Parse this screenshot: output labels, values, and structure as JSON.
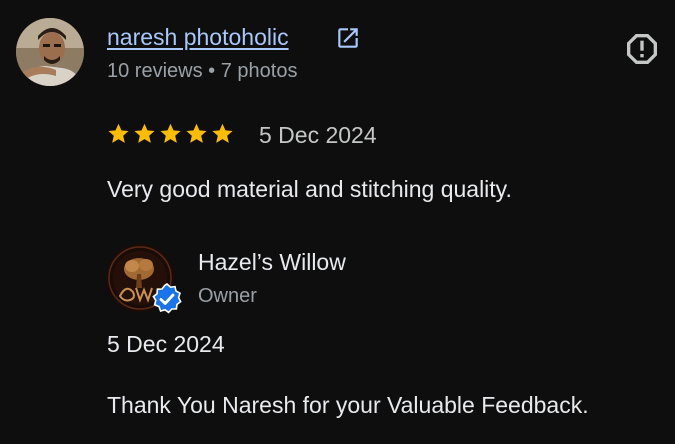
{
  "review": {
    "reviewer": {
      "name": "naresh photoholic",
      "meta": "10 reviews • 7 photos",
      "avatar_icon": "user-photo-avatar"
    },
    "rating": 5,
    "rating_max": 5,
    "star_color": "#fbbc04",
    "date": "5 Dec 2024",
    "text": "Very good material and stitching quality.",
    "icons": {
      "external_link": "external-link-icon",
      "report": "report-icon"
    }
  },
  "reply": {
    "owner_name": "Hazel’s Willow",
    "owner_role": "Owner",
    "date": "5 Dec 2024",
    "text": "Thank You Naresh for your Valuable Feedback.",
    "badge_icon": "verified-check-icon",
    "badge_color": "#1a73e8"
  },
  "colors": {
    "background": "#0e0e0e",
    "link": "#a8c7fa",
    "secondary_text": "#9aa0a6",
    "primary_text": "#e8eaed"
  }
}
